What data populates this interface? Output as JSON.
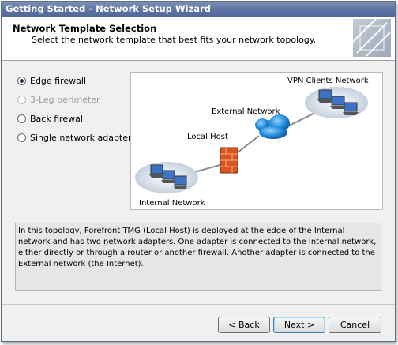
{
  "window": {
    "title": "Getting Started - Network Setup Wizard"
  },
  "header": {
    "title": "Network Template Selection",
    "subtitle": "Select the network template that best fits your network topology.",
    "logo_icon": "wizard-banner-icon"
  },
  "options": [
    {
      "label": "Edge firewall",
      "selected": true,
      "enabled": true
    },
    {
      "label": "3-Leg perimeter",
      "selected": false,
      "enabled": false
    },
    {
      "label": "Back firewall",
      "selected": false,
      "enabled": true
    },
    {
      "label": "Single network adapter",
      "selected": false,
      "enabled": true
    }
  ],
  "diagram": {
    "labels": {
      "vpn": "VPN Clients Network",
      "external": "External Network",
      "localhost": "Local Host",
      "internal": "Internal Network"
    },
    "icons": [
      "computer-group-icon",
      "cloud-icon",
      "firewall-icon"
    ]
  },
  "description": "In this topology, Forefront TMG (Local Host) is deployed at the edge of the Internal network and has two network adapters. One adapter is connected to the Internal network, either directly or through a router or another firewall. Another adapter is connected to the External network (the Internet).",
  "buttons": {
    "back": "< Back",
    "next": "Next >",
    "cancel": "Cancel"
  },
  "colors": {
    "titlebar": "#5b72a2",
    "cloud": "#1e88d6",
    "firewall": "#d9551e"
  }
}
